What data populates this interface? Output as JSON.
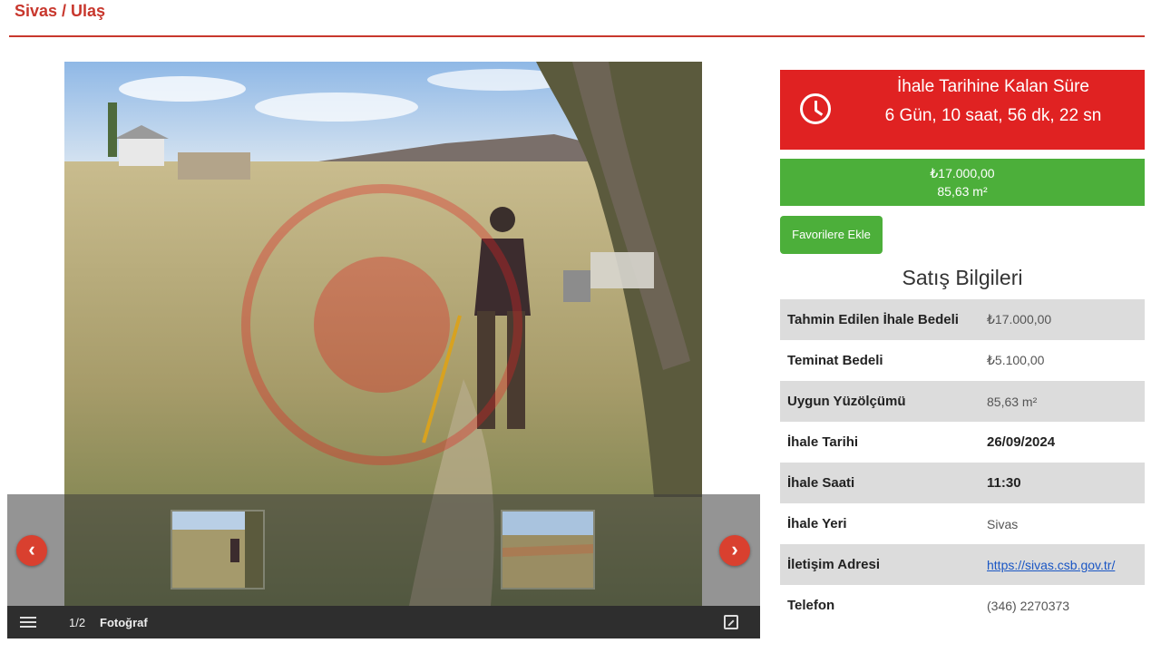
{
  "breadcrumb": "Sivas / Ulaş",
  "gallery": {
    "counter": "1/2",
    "caption": "Fotoğraf",
    "prev_label": "‹",
    "next_label": "›"
  },
  "countdown": {
    "title": "İhale Tarihine Kalan Süre",
    "value": "6 Gün, 10 saat, 56 dk, 22 sn"
  },
  "price": {
    "amount": "₺17.000,00",
    "area": "85,63 m²"
  },
  "favorite_button": "Favorilere Ekle",
  "section_title": "Satış Bilgileri",
  "info_rows": [
    {
      "label": "Tahmin Edilen İhale Bedeli",
      "value": "₺17.000,00"
    },
    {
      "label": "Teminat Bedeli",
      "value": "₺5.100,00"
    },
    {
      "label": "Uygun Yüzölçümü",
      "value": "85,63 m²"
    },
    {
      "label": "İhale Tarihi",
      "value": "26/09/2024"
    },
    {
      "label": "İhale Saati",
      "value": "11:30"
    },
    {
      "label": "İhale Yeri",
      "value": "Sivas"
    },
    {
      "label": "İletişim Adresi",
      "value": "https://sivas.csb.gov.tr/"
    },
    {
      "label": "Telefon",
      "value": "(346) 2270373"
    }
  ],
  "colors": {
    "accent_red": "#e02222",
    "accent_green": "#4caf3a",
    "breadcrumb_red": "#c8372d"
  }
}
